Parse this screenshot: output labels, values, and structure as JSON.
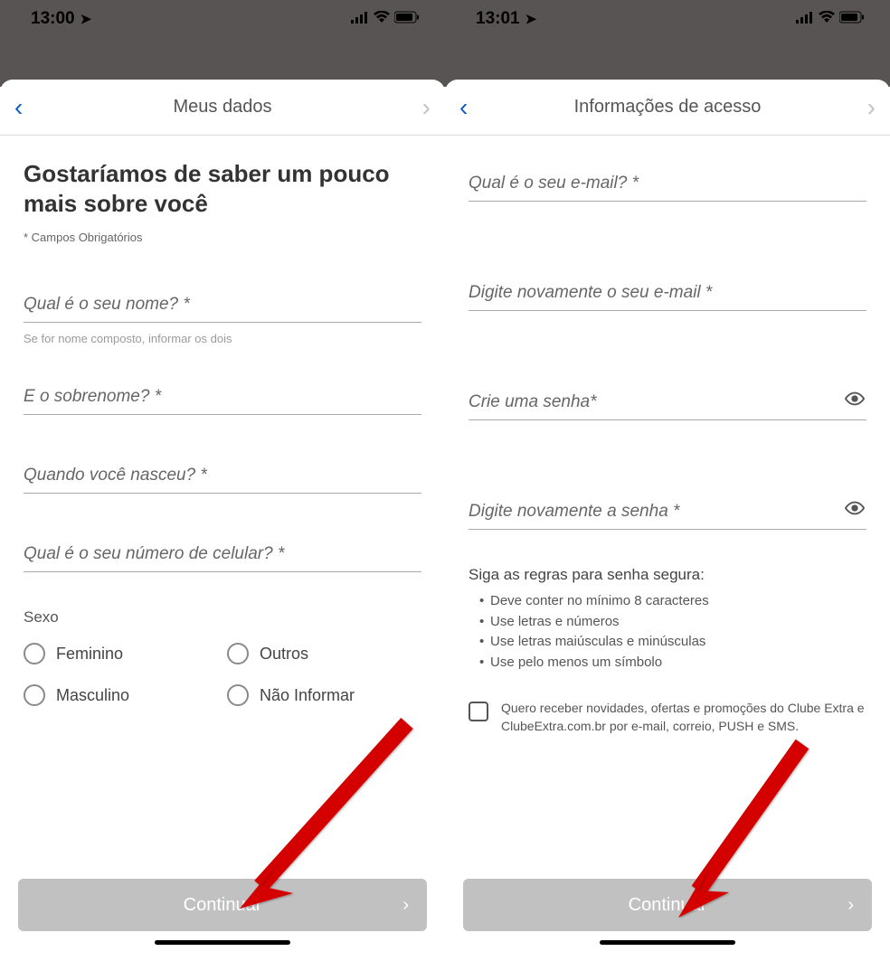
{
  "left": {
    "status": {
      "time": "13:00"
    },
    "nav": {
      "title": "Meus dados"
    },
    "heading": "Gostaríamos de saber um pouco mais sobre você",
    "required_note": "* Campos Obrigatórios",
    "fields": {
      "name": {
        "placeholder": "Qual é o seu nome? *",
        "helper": "Se for nome composto, informar os dois"
      },
      "surname": {
        "placeholder": "E o sobrenome? *"
      },
      "birthdate": {
        "placeholder": "Quando você nasceu? *"
      },
      "phone": {
        "placeholder": "Qual é o seu número de celular? *"
      }
    },
    "gender": {
      "label": "Sexo",
      "options": [
        "Feminino",
        "Outros",
        "Masculino",
        "Não Informar"
      ]
    },
    "cta": "Continuar"
  },
  "right": {
    "status": {
      "time": "13:01"
    },
    "nav": {
      "title": "Informações de acesso"
    },
    "fields": {
      "email": {
        "placeholder": "Qual é o seu e-mail? *"
      },
      "email_confirm": {
        "placeholder": "Digite novamente o seu e-mail *"
      },
      "password": {
        "placeholder": "Crie uma senha*"
      },
      "password_confirm": {
        "placeholder": "Digite novamente a senha *"
      }
    },
    "rules": {
      "title": "Siga as regras para senha segura:",
      "items": [
        "Deve conter no mínimo 8 caracteres",
        "Use letras e números",
        "Use letras maiúsculas e minúsculas",
        "Use pelo menos um símbolo"
      ]
    },
    "newsletter": "Quero receber novidades, ofertas e promoções do Clube Extra e ClubeExtra.com.br por e-mail, correio, PUSH e SMS.",
    "cta": "Continuar"
  }
}
